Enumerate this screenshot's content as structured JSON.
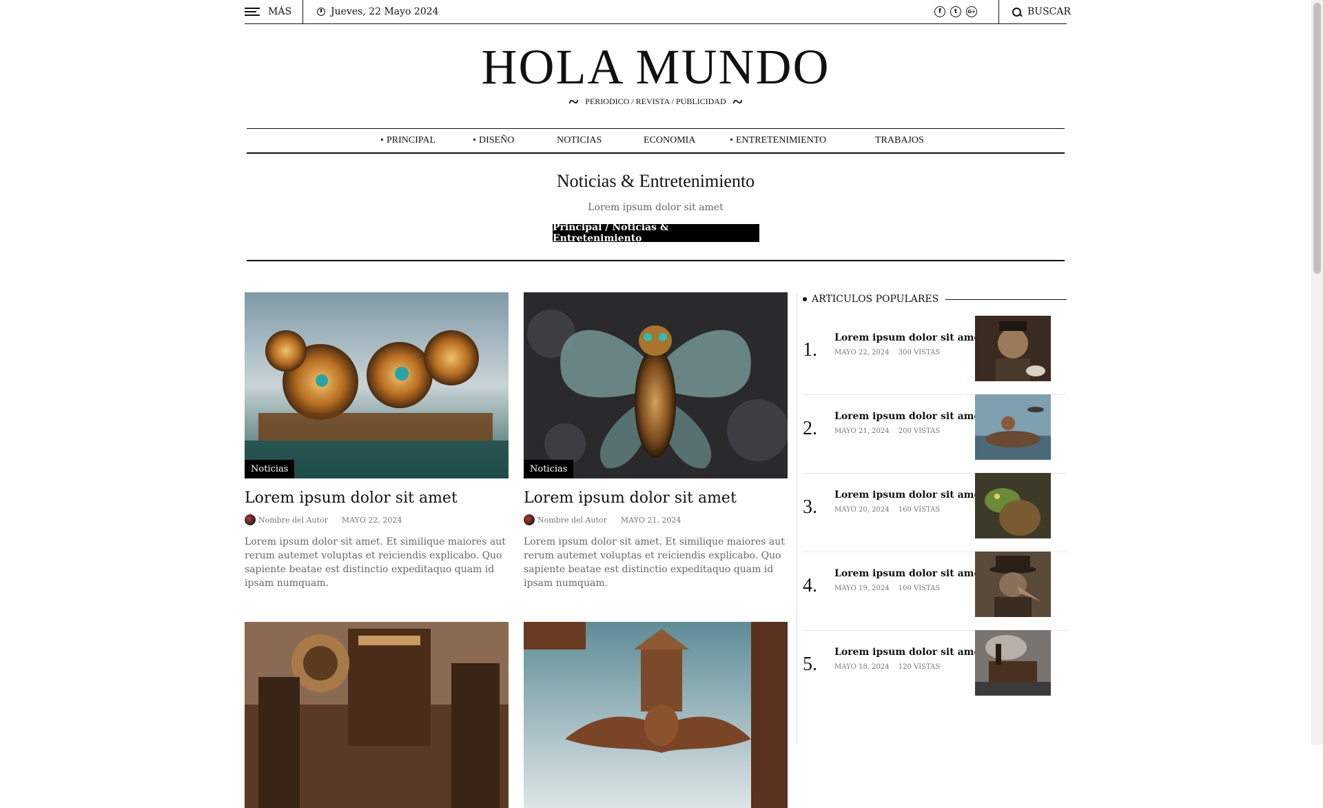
{
  "topbar": {
    "menu_label": "MÁS",
    "date": "Jueves, 22 Mayo 2024",
    "social": [
      "f",
      "t",
      "G+"
    ],
    "search_label": "BUSCAR"
  },
  "masthead": {
    "title": "HOLA MUNDO",
    "tagline": "PERIODICO / REVISTA / PUBLICIDAD"
  },
  "nav": {
    "items": [
      "PRINCIPAL",
      "DISEÑO",
      "NOTICIAS",
      "ECONOMIA",
      "ENTRETENIMIENTO",
      "TRABAJOS"
    ]
  },
  "section": {
    "title": "Noticias & Entretenimiento",
    "subtitle": "Lorem ipsum dolor sit amet",
    "breadcrumb": "Principal / Noticias & Entretenimiento"
  },
  "articles": [
    {
      "category": "Noticias",
      "title": "Lorem ipsum dolor sit amet",
      "author": "Nombre del Autor",
      "date": "MAYO 22, 2024",
      "excerpt": "Lorem ipsum dolor sit amet. Et similique maiores aut rerum autemet voluptas et reiciendis explicabo. Quo sapiente beatae est distinctio expeditaquo quam id ipsam numquam."
    },
    {
      "category": "Noticias",
      "title": "Lorem ipsum dolor sit amet",
      "author": "Nombre del Autor",
      "date": "MAYO 21, 2024",
      "excerpt": "Lorem ipsum dolor sit amet. Et similique maiores aut rerum autemet voluptas et reiciendis explicabo. Quo sapiente beatae est distinctio expeditaquo quam id ipsam numquam."
    }
  ],
  "sidebar": {
    "heading": "ARTICULOS POPULARES",
    "items": [
      {
        "num": "1.",
        "title": "Lorem ipsum dolor sit amet",
        "date": "MAYO 22, 2024",
        "views": "300 VISTAS"
      },
      {
        "num": "2.",
        "title": "Lorem ipsum dolor sit amet",
        "date": "MAYO 21, 2024",
        "views": "200 VISTAS"
      },
      {
        "num": "3.",
        "title": "Lorem ipsum dolor sit amet",
        "date": "MAYO 20, 2024",
        "views": "160 VISTAS"
      },
      {
        "num": "4.",
        "title": "Lorem ipsum dolor sit amet",
        "date": "MAYO 19, 2024",
        "views": "100 VISTAS"
      },
      {
        "num": "5.",
        "title": "Lorem ipsum dolor sit amet",
        "date": "MAYO 18, 2024",
        "views": "120 VISTAS"
      }
    ]
  }
}
